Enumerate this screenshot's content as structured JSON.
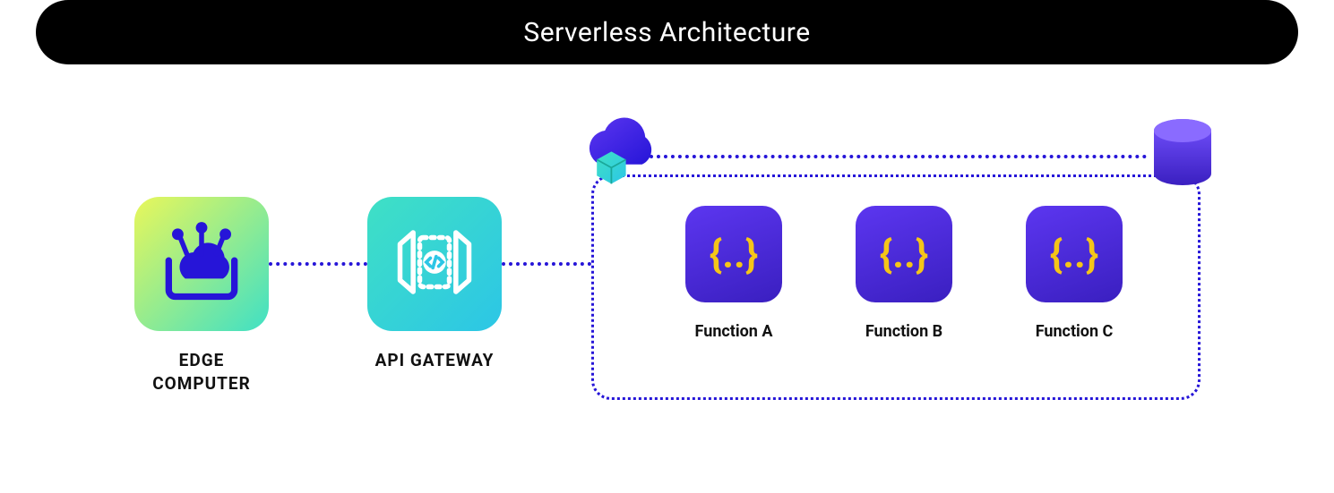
{
  "title": "Serverless Architecture",
  "nodes": {
    "edge": {
      "label": "EDGE COMPUTER"
    },
    "api": {
      "label": "API GATEWAY"
    }
  },
  "functions": [
    {
      "glyph": "{..}",
      "label": "Function A"
    },
    {
      "glyph": "{..}",
      "label": "Function B"
    },
    {
      "glyph": "{..}",
      "label": "Function C"
    }
  ],
  "icons": {
    "cloud": "cloud-with-cube-icon",
    "database": "database-cylinder-icon",
    "edge_icon": "cloud-network-icon",
    "api_icon": "code-gateway-icon"
  }
}
